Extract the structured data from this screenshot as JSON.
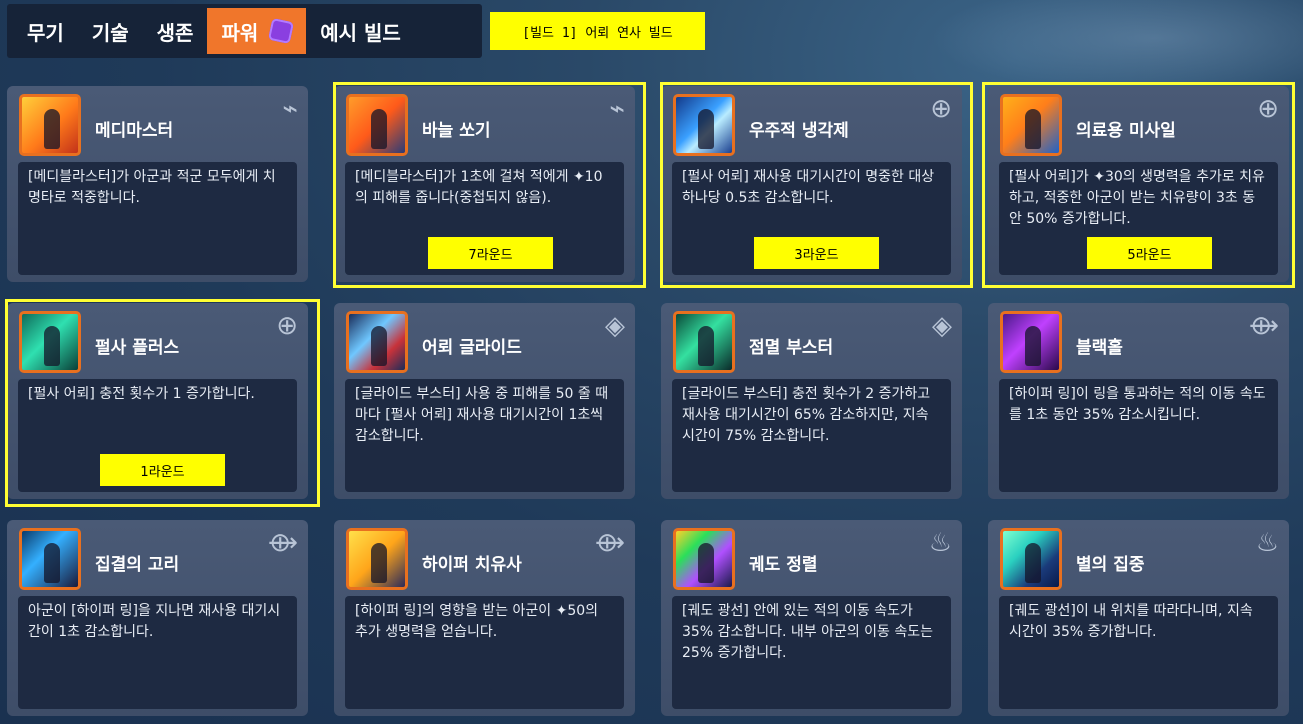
{
  "tabs": [
    "무기",
    "기술",
    "생존",
    "파워",
    "예시 빌드"
  ],
  "active_tab": "파워",
  "build_label": "[빌드 1] 어뢰 연사 빌드",
  "accent": "#f0762b",
  "highlight_color": "#ffff00",
  "cards": [
    {
      "title": "메디마스터",
      "desc": "[메디블라스터]가 아군과 적군 모두에게 치명타로 적중합니다.",
      "type_icon": "weapon-icon",
      "round": ""
    },
    {
      "title": "바늘 쏘기",
      "desc": "[메디블라스터]가 1초에 걸쳐 적에게 ✦10의 피해를 줍니다(중첩되지 않음).",
      "type_icon": "weapon-icon",
      "round": "7라운드"
    },
    {
      "title": "우주적 냉각제",
      "desc": "[펄사 어뢰] 재사용 대기시간이 명중한 대상 하나당 0.5초 감소합니다.",
      "type_icon": "ability-icon",
      "round": "3라운드"
    },
    {
      "title": "의료용 미사일",
      "desc": "[펄사 어뢰]가 ✦30의 생명력을 추가로 치유하고, 적중한 아군이 받는 치유량이 3초 동안 50% 증가합니다.",
      "type_icon": "ability-icon",
      "round": "5라운드"
    },
    {
      "title": "펄사 플러스",
      "desc": "[펄사 어뢰] 충전 횟수가 1 증가합니다.",
      "type_icon": "ability-icon",
      "round": "1라운드"
    },
    {
      "title": "어뢰 글라이드",
      "desc": "[글라이드 부스터] 사용 중 피해를 50 줄 때마다 [펄사 어뢰] 재사용 대기시간이 1초씩 감소합니다.",
      "type_icon": "diamond-icon",
      "round": ""
    },
    {
      "title": "점멸 부스터",
      "desc": "[글라이드 부스터] 충전 횟수가 2 증가하고 재사용 대기시간이 65% 감소하지만, 지속 시간이 75% 감소합니다.",
      "type_icon": "diamond-icon",
      "round": ""
    },
    {
      "title": "블랙홀",
      "desc": "[하이퍼 링]이 링을 통과하는 적의 이동 속도를 1초 동안 35% 감소시킵니다.",
      "type_icon": "ring-icon",
      "round": ""
    },
    {
      "title": "집결의 고리",
      "desc": "아군이 [하이퍼 링]을 지나면 재사용 대기시간이 1초 감소합니다.",
      "type_icon": "ring-icon",
      "round": ""
    },
    {
      "title": "하이퍼 치유사",
      "desc": "[하이퍼 링]의 영향을 받는 아군이 ✦50의 추가 생명력을 얻습니다.",
      "type_icon": "ring-icon",
      "round": ""
    },
    {
      "title": "궤도 정렬",
      "desc": "[궤도 광선] 안에 있는 적의 이동 속도가 35% 감소합니다. 내부 아군의 이동 속도는 25% 증가합니다.",
      "type_icon": "ultimate-icon",
      "round": ""
    },
    {
      "title": "별의 집중",
      "desc": "[궤도 광선]이 내 위치를 따라다니며, 지속 시간이 35% 증가합니다.",
      "type_icon": "ultimate-icon",
      "round": ""
    }
  ]
}
